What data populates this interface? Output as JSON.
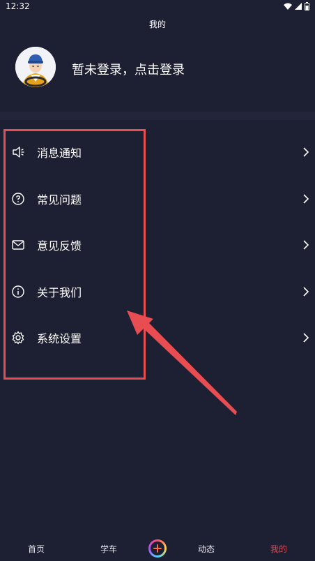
{
  "status": {
    "time": "12:32"
  },
  "header": {
    "title": "我的"
  },
  "profile": {
    "login_text": "暂未登录，点击登录"
  },
  "menu": {
    "items": [
      {
        "label": "消息通知",
        "icon": "speaker-icon"
      },
      {
        "label": "常见问题",
        "icon": "question-circle-icon"
      },
      {
        "label": "意见反馈",
        "icon": "mail-icon"
      },
      {
        "label": "关于我们",
        "icon": "info-circle-icon"
      },
      {
        "label": "系统设置",
        "icon": "gear-icon"
      }
    ]
  },
  "tabbar": {
    "tabs": [
      {
        "label": "首页"
      },
      {
        "label": "学车"
      },
      {
        "label": "动态"
      },
      {
        "label": "我的"
      }
    ],
    "active": "我的"
  },
  "colors": {
    "background": "#1d2032",
    "accent": "#e84d52",
    "active_tab": "#e04550"
  }
}
